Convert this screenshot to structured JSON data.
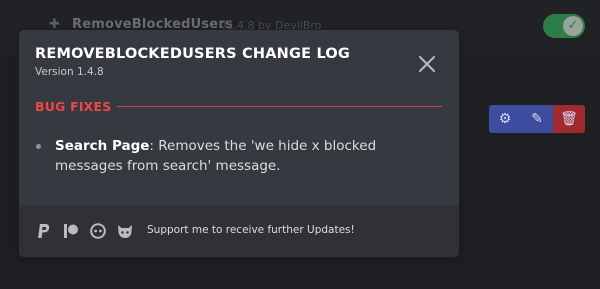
{
  "background": {
    "plugin_name": "RemoveBlockedUsers",
    "plugin_meta": "v1.4.8 by DevilBro",
    "toggle_on": true,
    "actions": [
      "settings-icon",
      "edit-icon",
      "trash-icon"
    ]
  },
  "modal": {
    "title": "REMOVEBLOCKEDUSERS CHANGE LOG",
    "version": "Version 1.4.8",
    "sections": [
      {
        "title": "BUG FIXES",
        "color": "#f04747",
        "entries": [
          {
            "strong": "Search Page",
            "text": ": Removes the 'we hide x blocked messages from search' message."
          }
        ]
      }
    ],
    "footer": {
      "icons": [
        "paypal-icon",
        "patreon-icon",
        "ko-fi-icon",
        "github-sponsors-icon"
      ],
      "text": "Support me to receive further Updates!"
    }
  }
}
